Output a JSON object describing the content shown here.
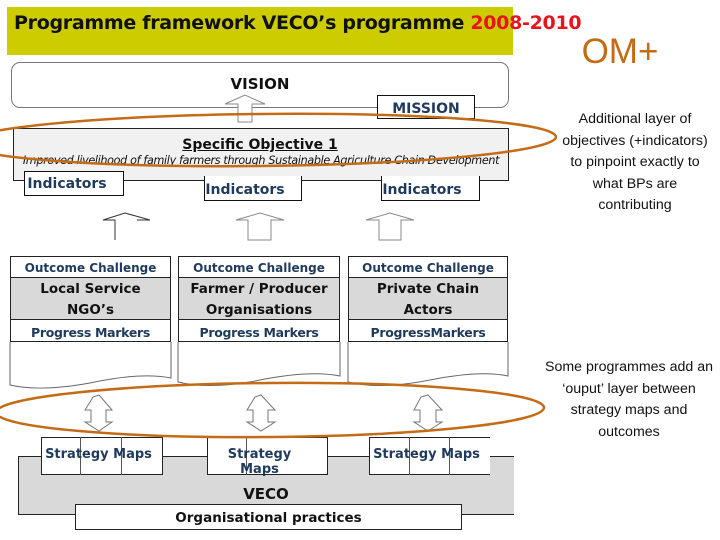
{
  "header": {
    "title_main": "Programme framework VECO’s programme ",
    "title_years": "2008-2010"
  },
  "framework": {
    "vision_label": "VISION",
    "mission_label": "MISSION",
    "objective": {
      "title": "Specific Objective 1",
      "description": "Improved livelihood of family farmers through Sustainable Agriculture Chain Development",
      "indicators": [
        "Indicators",
        "Indicators",
        "Indicators"
      ]
    },
    "outcome_columns": [
      {
        "header": "Outcome Challenge",
        "name_line1": "Local  Service",
        "name_line2": "NGO’s",
        "markers_label": "Progress Markers"
      },
      {
        "header": "Outcome Challenge",
        "name_line1": "Farmer / Producer",
        "name_line2": "Organisations",
        "markers_label": "Progress Markers"
      },
      {
        "header": "Outcome Challenge",
        "name_line1": "Private Chain",
        "name_line2": "Actors",
        "markers_label": "ProgressMarkers"
      }
    ],
    "strategy_maps": [
      "Strategy Maps",
      "Strategy Maps",
      "Strategy Maps"
    ],
    "veco_label": "VECO",
    "org_practices_label": "Organisational practices"
  },
  "annotations": {
    "om_plus": "OM+",
    "note_objectives": "Additional layer of objectives (+indicators) to pinpoint exactly to what BPs are contributing",
    "note_output": "Some programmes add an ‘ouput’ layer between strategy maps and outcomes"
  },
  "colors": {
    "banner": "#cccc00",
    "years": "#e8141c",
    "highlight_ellipse": "#c46b16",
    "label_blue": "#1f3a5c",
    "grey_fill": "#d9d9d9"
  }
}
